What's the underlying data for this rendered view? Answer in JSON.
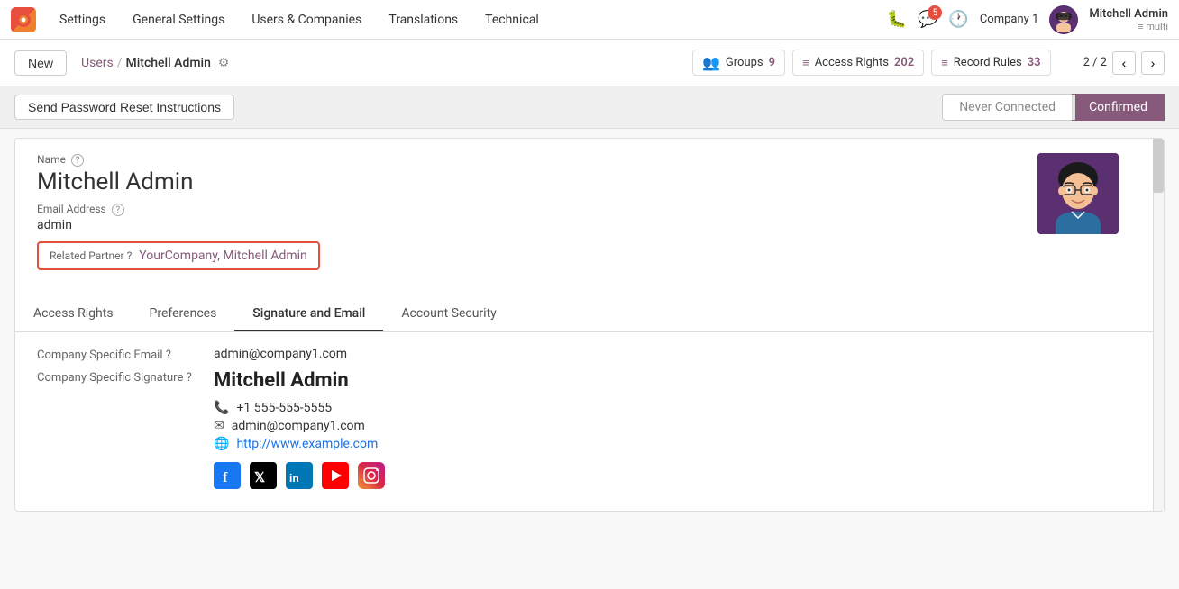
{
  "topnav": {
    "logo_text": "O",
    "menu_items": [
      "Settings",
      "General Settings",
      "Users & Companies",
      "Translations",
      "Technical"
    ],
    "notification_count": "5",
    "company": "Company 1",
    "user_name": "Mitchell Admin",
    "user_sub": "≡ multi"
  },
  "actionbar": {
    "new_label": "New",
    "breadcrumb_parent": "Users",
    "breadcrumb_current": "Mitchell Admin",
    "stats": [
      {
        "icon": "👥",
        "label": "Groups",
        "count": "9"
      },
      {
        "icon": "≡",
        "label": "Access Rights",
        "count": "202"
      },
      {
        "icon": "≡",
        "label": "Record Rules",
        "count": "33"
      }
    ],
    "pagination": "2 / 2"
  },
  "statusbar": {
    "send_reset_label": "Send Password Reset Instructions",
    "steps": [
      {
        "label": "Never Connected",
        "active": false
      },
      {
        "label": "Confirmed",
        "active": true
      }
    ]
  },
  "form": {
    "name_label": "Name",
    "name_value": "Mitchell Admin",
    "email_label": "Email Address",
    "email_value": "admin",
    "related_partner_label": "Related Partner",
    "related_partner_value": "YourCompany, Mitchell Admin"
  },
  "tabs": [
    {
      "id": "access-rights",
      "label": "Access Rights"
    },
    {
      "id": "preferences",
      "label": "Preferences"
    },
    {
      "id": "signature-email",
      "label": "Signature and Email",
      "active": true
    },
    {
      "id": "account-security",
      "label": "Account Security"
    }
  ],
  "tab_content": {
    "company_email_label": "Company Specific Email",
    "company_email_value": "admin@company1.com",
    "company_sig_label": "Company Specific Signature",
    "sig_name": "Mitchell Admin",
    "sig_phone": "+1 555-555-5555",
    "sig_email": "admin@company1.com",
    "sig_website": "http://www.example.com",
    "social": [
      "facebook",
      "twitter-x",
      "linkedin",
      "youtube",
      "instagram"
    ]
  },
  "icons": {
    "gear": "⚙",
    "chevron_left": "‹",
    "chevron_right": "›",
    "bell": "🔔",
    "clock": "🕐",
    "bug": "🐛",
    "phone": "📞",
    "email": "✉",
    "globe": "🌐",
    "facebook": "f",
    "twitter": "𝕏",
    "linkedin": "in",
    "youtube": "▶",
    "instagram": "◎"
  }
}
